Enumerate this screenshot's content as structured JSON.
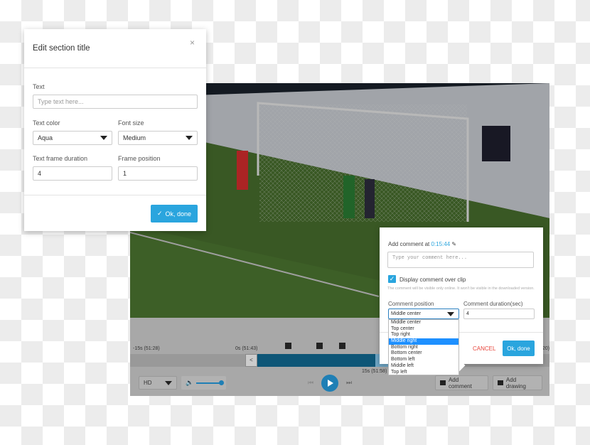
{
  "edit_dialog": {
    "title": "Edit section title",
    "close_icon": "close-icon",
    "text_label": "Text",
    "text_placeholder": "Type text here...",
    "text_color_label": "Text color",
    "text_color_value": "Aqua",
    "font_size_label": "Font size",
    "font_size_value": "Medium",
    "duration_label": "Text frame duration",
    "duration_value": "4",
    "position_label": "Frame position",
    "position_value": "1",
    "ok_label": "Ok, done"
  },
  "timeline": {
    "start_label": "-15s (51:28)",
    "zero_label": "0s (51:43)",
    "end_label": "15s (51:58)",
    "right_label": "20)",
    "back_label": "<"
  },
  "controls": {
    "quality": "HD",
    "volume_percent": 100,
    "add_comment": "Add comment",
    "add_drawing": "Add drawing"
  },
  "comment_popup": {
    "title": "Add comment at",
    "time": "0:15:44",
    "placeholder": "Type your comment here...",
    "display_label": "Display comment over clip",
    "display_checked": true,
    "note": "The comment will be visible only online. It won't be visible in the downloaded version.",
    "position_label": "Comment position",
    "position_value": "Middle center",
    "duration_label": "Comment duration(sec)",
    "duration_value": "4",
    "cancel": "CANCEL",
    "ok": "Ok, done",
    "options": [
      "Middle center",
      "Top center",
      "Top right",
      "Middle right",
      "Bottom right",
      "Bottom center",
      "Bottom left",
      "Middle left",
      "Top left"
    ],
    "selected_option": "Middle right"
  },
  "colors": {
    "accent": "#2aa5de",
    "cancel": "#e8473d",
    "progress": "#0e5677"
  }
}
